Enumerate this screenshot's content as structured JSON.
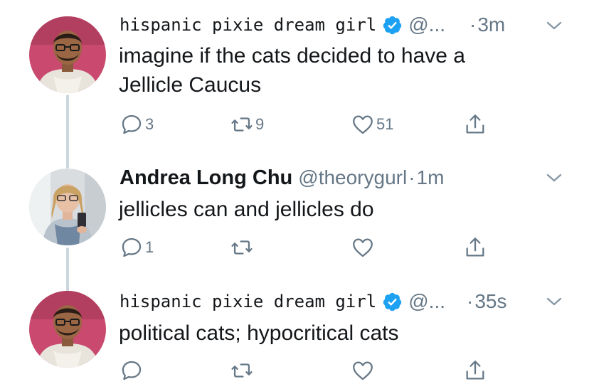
{
  "tweets": [
    {
      "display_name": "hispanic pixie dream girl",
      "handle": "@...",
      "separator": "·",
      "time": "3m",
      "text_lines": [
        "imagine if the cats decided to have a",
        "Jellicle Caucus"
      ],
      "replies": "3",
      "retweets": "9",
      "likes": "51",
      "verified": true,
      "avatar_icon": "person-avatar-pink-bg"
    },
    {
      "display_name": "Andrea Long Chu",
      "handle": "@theorygurl",
      "separator": "·",
      "time": "1m",
      "text_lines": [
        "jellicles can and jellicles do"
      ],
      "replies": "1",
      "retweets": "",
      "likes": "",
      "verified": false,
      "avatar_icon": "person-avatar-mirror-selfie"
    },
    {
      "display_name": "hispanic pixie dream girl",
      "handle": "@...",
      "separator": "·",
      "time": "35s",
      "text_lines": [
        "political cats; hypocritical cats"
      ],
      "replies": "",
      "retweets": "",
      "likes": "",
      "verified": true,
      "avatar_icon": "person-avatar-pink-bg"
    }
  ],
  "icons": {
    "reply": "reply-icon",
    "retweet": "retweet-icon",
    "like": "like-icon",
    "share": "share-icon",
    "caret": "chevron-down-icon",
    "verified": "verified-badge-icon"
  },
  "colors": {
    "text": "#14171a",
    "secondary": "#657786",
    "verified_blue": "#1da1f2",
    "thread_line": "#ccd6dd",
    "avatar_pink": "#c94a6e"
  }
}
